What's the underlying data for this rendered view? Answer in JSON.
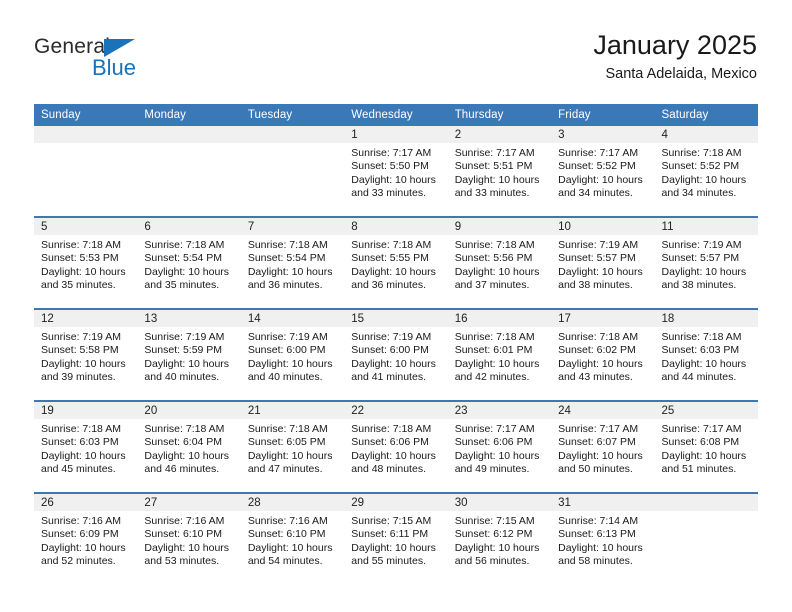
{
  "brand": {
    "name_top": "General",
    "name_bottom": "Blue",
    "triangle_color": "#1a72ba",
    "text_color": "#2b2b2b"
  },
  "header": {
    "title": "January 2025",
    "subtitle": "Santa Adelaida, Mexico",
    "accent_color": "#3b78b8",
    "daynum_band_color": "#f0f0f0"
  },
  "calendar": {
    "weekday_headers": [
      "Sunday",
      "Monday",
      "Tuesday",
      "Wednesday",
      "Thursday",
      "Friday",
      "Saturday"
    ],
    "weeks": [
      [
        {
          "day": "",
          "lines": []
        },
        {
          "day": "",
          "lines": []
        },
        {
          "day": "",
          "lines": []
        },
        {
          "day": "1",
          "lines": [
            "Sunrise: 7:17 AM",
            "Sunset: 5:50 PM",
            "Daylight: 10 hours",
            "and 33 minutes."
          ]
        },
        {
          "day": "2",
          "lines": [
            "Sunrise: 7:17 AM",
            "Sunset: 5:51 PM",
            "Daylight: 10 hours",
            "and 33 minutes."
          ]
        },
        {
          "day": "3",
          "lines": [
            "Sunrise: 7:17 AM",
            "Sunset: 5:52 PM",
            "Daylight: 10 hours",
            "and 34 minutes."
          ]
        },
        {
          "day": "4",
          "lines": [
            "Sunrise: 7:18 AM",
            "Sunset: 5:52 PM",
            "Daylight: 10 hours",
            "and 34 minutes."
          ]
        }
      ],
      [
        {
          "day": "5",
          "lines": [
            "Sunrise: 7:18 AM",
            "Sunset: 5:53 PM",
            "Daylight: 10 hours",
            "and 35 minutes."
          ]
        },
        {
          "day": "6",
          "lines": [
            "Sunrise: 7:18 AM",
            "Sunset: 5:54 PM",
            "Daylight: 10 hours",
            "and 35 minutes."
          ]
        },
        {
          "day": "7",
          "lines": [
            "Sunrise: 7:18 AM",
            "Sunset: 5:54 PM",
            "Daylight: 10 hours",
            "and 36 minutes."
          ]
        },
        {
          "day": "8",
          "lines": [
            "Sunrise: 7:18 AM",
            "Sunset: 5:55 PM",
            "Daylight: 10 hours",
            "and 36 minutes."
          ]
        },
        {
          "day": "9",
          "lines": [
            "Sunrise: 7:18 AM",
            "Sunset: 5:56 PM",
            "Daylight: 10 hours",
            "and 37 minutes."
          ]
        },
        {
          "day": "10",
          "lines": [
            "Sunrise: 7:19 AM",
            "Sunset: 5:57 PM",
            "Daylight: 10 hours",
            "and 38 minutes."
          ]
        },
        {
          "day": "11",
          "lines": [
            "Sunrise: 7:19 AM",
            "Sunset: 5:57 PM",
            "Daylight: 10 hours",
            "and 38 minutes."
          ]
        }
      ],
      [
        {
          "day": "12",
          "lines": [
            "Sunrise: 7:19 AM",
            "Sunset: 5:58 PM",
            "Daylight: 10 hours",
            "and 39 minutes."
          ]
        },
        {
          "day": "13",
          "lines": [
            "Sunrise: 7:19 AM",
            "Sunset: 5:59 PM",
            "Daylight: 10 hours",
            "and 40 minutes."
          ]
        },
        {
          "day": "14",
          "lines": [
            "Sunrise: 7:19 AM",
            "Sunset: 6:00 PM",
            "Daylight: 10 hours",
            "and 40 minutes."
          ]
        },
        {
          "day": "15",
          "lines": [
            "Sunrise: 7:19 AM",
            "Sunset: 6:00 PM",
            "Daylight: 10 hours",
            "and 41 minutes."
          ]
        },
        {
          "day": "16",
          "lines": [
            "Sunrise: 7:18 AM",
            "Sunset: 6:01 PM",
            "Daylight: 10 hours",
            "and 42 minutes."
          ]
        },
        {
          "day": "17",
          "lines": [
            "Sunrise: 7:18 AM",
            "Sunset: 6:02 PM",
            "Daylight: 10 hours",
            "and 43 minutes."
          ]
        },
        {
          "day": "18",
          "lines": [
            "Sunrise: 7:18 AM",
            "Sunset: 6:03 PM",
            "Daylight: 10 hours",
            "and 44 minutes."
          ]
        }
      ],
      [
        {
          "day": "19",
          "lines": [
            "Sunrise: 7:18 AM",
            "Sunset: 6:03 PM",
            "Daylight: 10 hours",
            "and 45 minutes."
          ]
        },
        {
          "day": "20",
          "lines": [
            "Sunrise: 7:18 AM",
            "Sunset: 6:04 PM",
            "Daylight: 10 hours",
            "and 46 minutes."
          ]
        },
        {
          "day": "21",
          "lines": [
            "Sunrise: 7:18 AM",
            "Sunset: 6:05 PM",
            "Daylight: 10 hours",
            "and 47 minutes."
          ]
        },
        {
          "day": "22",
          "lines": [
            "Sunrise: 7:18 AM",
            "Sunset: 6:06 PM",
            "Daylight: 10 hours",
            "and 48 minutes."
          ]
        },
        {
          "day": "23",
          "lines": [
            "Sunrise: 7:17 AM",
            "Sunset: 6:06 PM",
            "Daylight: 10 hours",
            "and 49 minutes."
          ]
        },
        {
          "day": "24",
          "lines": [
            "Sunrise: 7:17 AM",
            "Sunset: 6:07 PM",
            "Daylight: 10 hours",
            "and 50 minutes."
          ]
        },
        {
          "day": "25",
          "lines": [
            "Sunrise: 7:17 AM",
            "Sunset: 6:08 PM",
            "Daylight: 10 hours",
            "and 51 minutes."
          ]
        }
      ],
      [
        {
          "day": "26",
          "lines": [
            "Sunrise: 7:16 AM",
            "Sunset: 6:09 PM",
            "Daylight: 10 hours",
            "and 52 minutes."
          ]
        },
        {
          "day": "27",
          "lines": [
            "Sunrise: 7:16 AM",
            "Sunset: 6:10 PM",
            "Daylight: 10 hours",
            "and 53 minutes."
          ]
        },
        {
          "day": "28",
          "lines": [
            "Sunrise: 7:16 AM",
            "Sunset: 6:10 PM",
            "Daylight: 10 hours",
            "and 54 minutes."
          ]
        },
        {
          "day": "29",
          "lines": [
            "Sunrise: 7:15 AM",
            "Sunset: 6:11 PM",
            "Daylight: 10 hours",
            "and 55 minutes."
          ]
        },
        {
          "day": "30",
          "lines": [
            "Sunrise: 7:15 AM",
            "Sunset: 6:12 PM",
            "Daylight: 10 hours",
            "and 56 minutes."
          ]
        },
        {
          "day": "31",
          "lines": [
            "Sunrise: 7:14 AM",
            "Sunset: 6:13 PM",
            "Daylight: 10 hours",
            "and 58 minutes."
          ]
        },
        {
          "day": "",
          "lines": []
        }
      ]
    ]
  }
}
